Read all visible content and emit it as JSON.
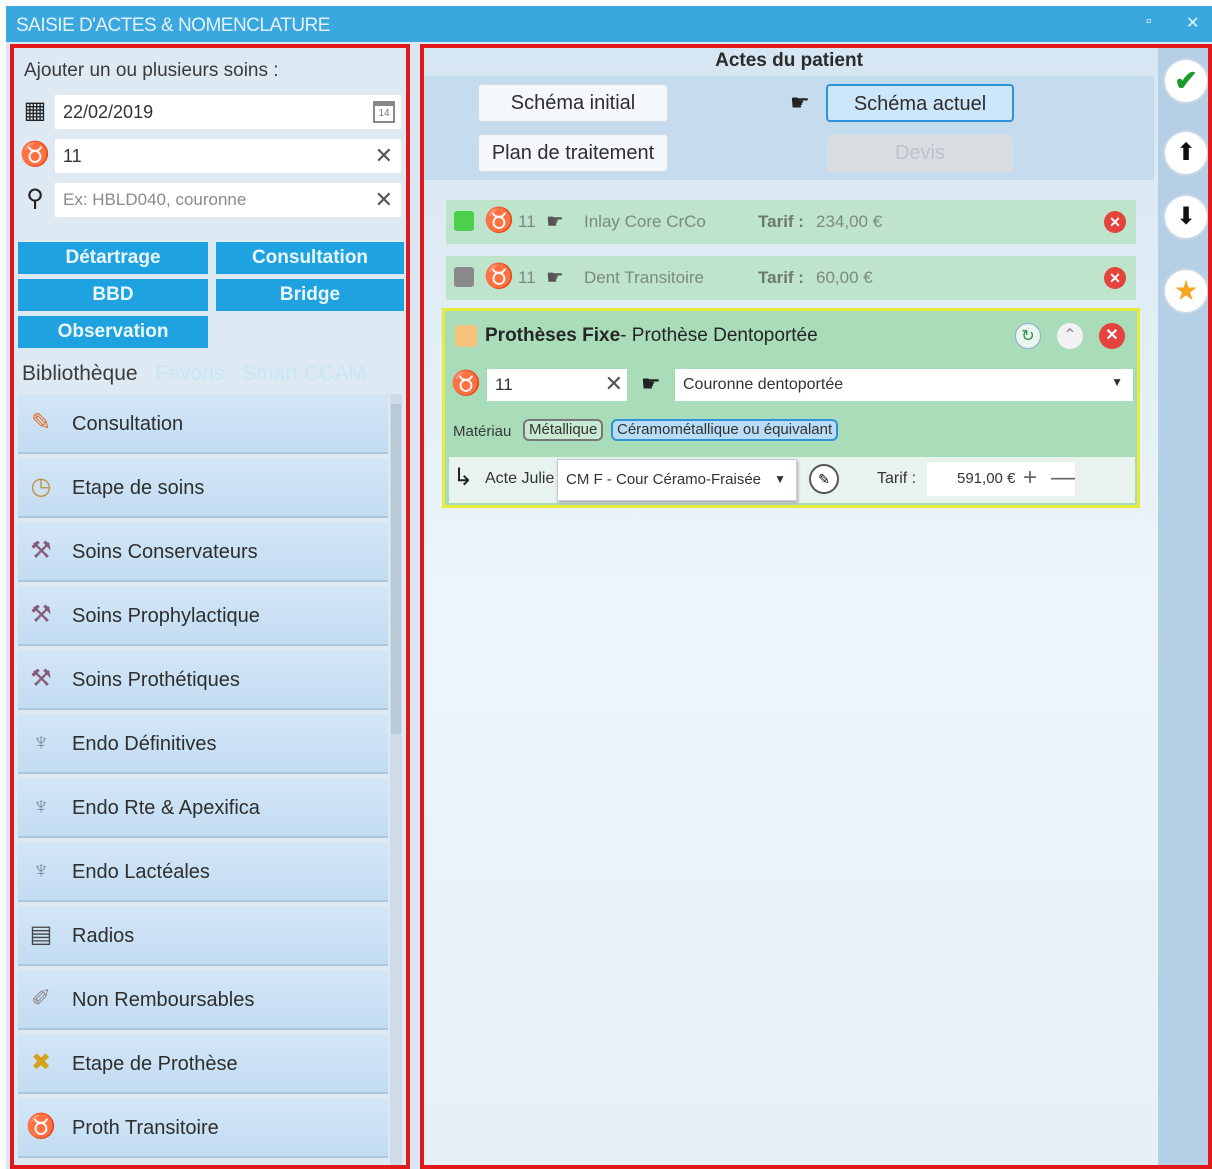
{
  "window": {
    "title": "SAISIE D'ACTES & NOMENCLATURE",
    "restore_glyph": "▫",
    "close_glyph": "✕"
  },
  "left": {
    "header": "Ajouter un ou plusieurs soins :",
    "date_value": "22/02/2019",
    "date_cal_small": "14",
    "tooth_value": "11",
    "search_placeholder": "Ex: HBLD040, couronne",
    "quick_buttons": [
      "Détartrage",
      "Consultation",
      "BBD",
      "Bridge",
      "Observation"
    ],
    "tabs": [
      "Bibliothèque",
      "Favoris",
      "Smart CCAM"
    ],
    "library": [
      {
        "label": "Consultation",
        "icon": "consultation-icon"
      },
      {
        "label": "Etape de soins",
        "icon": "clock-icon"
      },
      {
        "label": "Soins Conservateurs",
        "icon": "dental-tool-icon"
      },
      {
        "label": "Soins Prophylactique",
        "icon": "dental-tool-icon"
      },
      {
        "label": "Soins Prothétiques",
        "icon": "dental-tool-icon"
      },
      {
        "label": "Endo Définitives",
        "icon": "tooth-root-icon"
      },
      {
        "label": "Endo Rte & Apexifica",
        "icon": "tooth-root-icon"
      },
      {
        "label": "Endo Lactéales",
        "icon": "tooth-root-icon"
      },
      {
        "label": "Radios",
        "icon": "xray-icon"
      },
      {
        "label": "Non Remboursables",
        "icon": "note-icon"
      },
      {
        "label": "Etape de Prothèse",
        "icon": "cross-tools-icon"
      },
      {
        "label": "Proth Transitoire",
        "icon": "tooth-icon"
      }
    ]
  },
  "right": {
    "title": "Actes du patient",
    "btn_schema_initial": "Schéma initial",
    "btn_schema_actuel": "Schéma actuel",
    "btn_plan": "Plan de traitement",
    "btn_devis": "Devis",
    "actes": [
      {
        "color": "#4cd04c",
        "tooth": "11",
        "name": "Inlay Core CrCo",
        "tarif_label": "Tarif :",
        "tarif": "234,00 €"
      },
      {
        "color": "#8a8a8a",
        "tooth": "11",
        "name": "Dent Transitoire",
        "tarif_label": "Tarif :",
        "tarif": "60,00 €"
      }
    ],
    "card": {
      "title_bold": "Prothèses Fixe",
      "title_rest": "- Prothèse Dentoportée",
      "tooth": "11",
      "select_value": "Couronne dentoportée",
      "materiau_label": "Matériau",
      "chip1": "Métallique",
      "chip2": "Céramométallique ou équivalant",
      "acte_label": "Acte Julie",
      "acte_value": "CM F - Cour Céramo-Fraisée",
      "tarif_label": "Tarif :",
      "tarif_value": "591,00 €"
    }
  },
  "colors": {
    "accent": "#1fa3e0",
    "titlebar": "#3aa7df",
    "highlight_border": "#e01a1a",
    "card_border": "#e5ec3b",
    "acte_bg": "#bfe4cc"
  }
}
